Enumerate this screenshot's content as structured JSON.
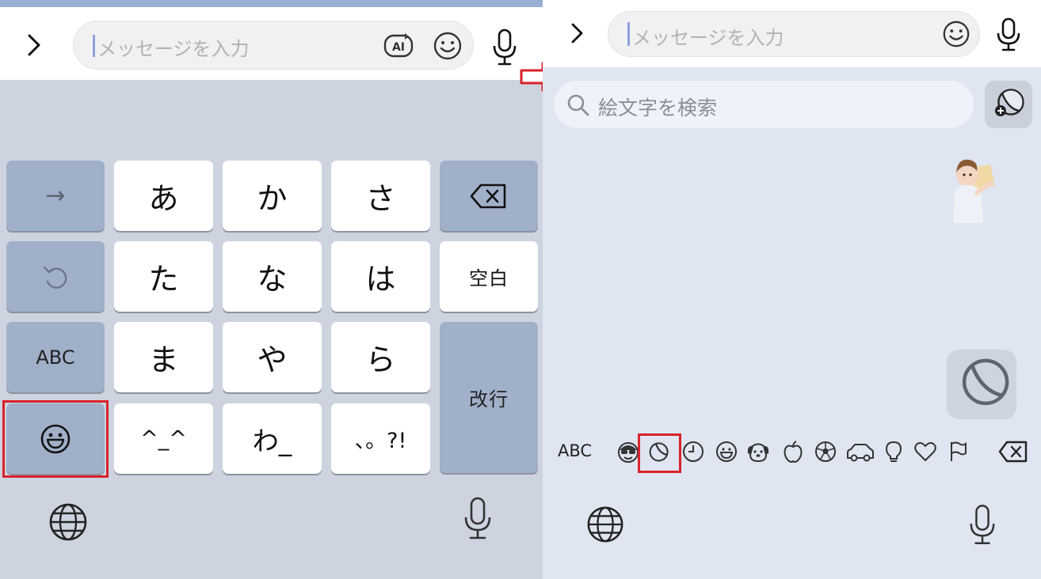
{
  "left": {
    "input": {
      "placeholder": "メッセージを入力"
    },
    "ai_label": "AI",
    "keys": {
      "a": "あ",
      "ka": "か",
      "sa": "さ",
      "ta": "た",
      "na": "な",
      "ha": "は",
      "ma": "ま",
      "ya": "や",
      "ra": "ら",
      "kaomoji": "^_^",
      "wa": "わ_",
      "punct": "、。?!",
      "space": "空白",
      "abc": "ABC",
      "enter": "改行",
      "arrow": "→"
    }
  },
  "right": {
    "input": {
      "placeholder": "メッセージを入力"
    },
    "search_placeholder": "絵文字を検索",
    "category_abc": "ABC",
    "categories": [
      "smiley-sunglasses-icon",
      "sticker-icon",
      "clock-icon",
      "smiley-icon",
      "dog-icon",
      "apple-icon",
      "soccer-ball-icon",
      "car-icon",
      "lightbulb-icon",
      "heart-icon",
      "flag-icon"
    ]
  },
  "colors": {
    "highlight_red": "#d8222b",
    "keyboard_bg": "#cdd4e0",
    "emoji_panel_bg": "#dfe5f1",
    "caret": "#8ca0dc"
  }
}
